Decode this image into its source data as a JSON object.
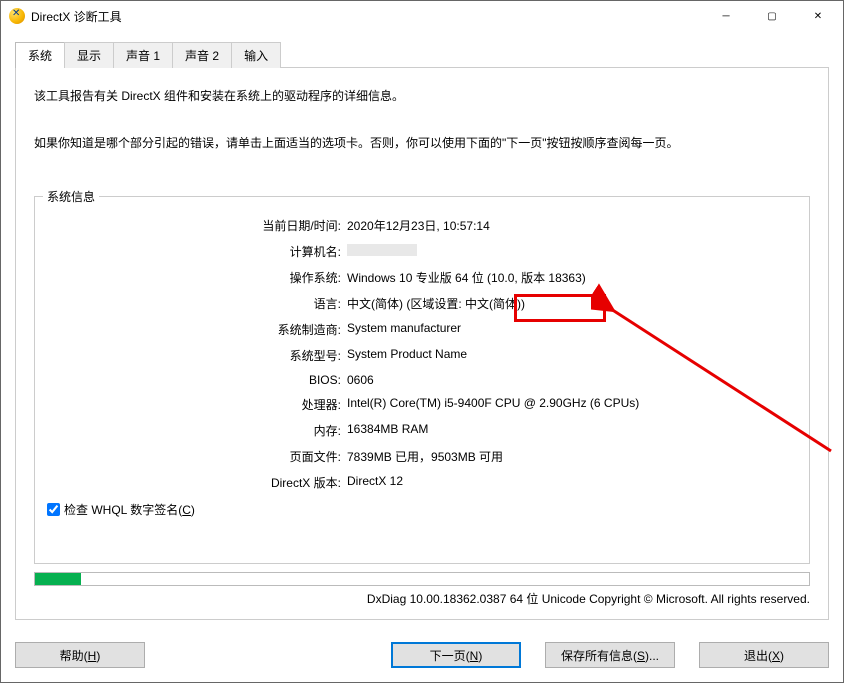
{
  "window": {
    "title": "DirectX 诊断工具"
  },
  "tabs": {
    "system": "系统",
    "display": "显示",
    "sound1": "声音 1",
    "sound2": "声音 2",
    "input": "输入"
  },
  "intro": {
    "line1": "该工具报告有关 DirectX 组件和安装在系统上的驱动程序的详细信息。",
    "line2": "如果你知道是哪个部分引起的错误，请单击上面适当的选项卡。否则，你可以使用下面的\"下一页\"按钮按顺序查阅每一页。"
  },
  "fieldset": {
    "legend": "系统信息"
  },
  "labels": {
    "datetime": "当前日期/时间",
    "computer": "计算机名",
    "os": "操作系统",
    "lang": "语言",
    "manufacturer": "系统制造商",
    "model": "系统型号",
    "bios": "BIOS",
    "cpu": "处理器",
    "mem": "内存",
    "page": "页面文件",
    "dx": "DirectX 版本"
  },
  "values": {
    "datetime": "2020年12月23日, 10:57:14",
    "os_a": "Windows 10 专业版 64 位 (10.0,",
    "os_b": "版本 18363)",
    "lang": "中文(简体) (区域设置: 中文(简体))",
    "manufacturer": "System manufacturer",
    "model": "System Product Name",
    "bios": "0606",
    "cpu": "Intel(R) Core(TM) i5-9400F CPU @ 2.90GHz (6 CPUs)",
    "mem": "16384MB RAM",
    "page": "7839MB 已用，9503MB 可用",
    "dx": "DirectX 12"
  },
  "checkbox": {
    "label_a": "检查 WHQL 数字签名(",
    "label_u": "C",
    "label_b": ")"
  },
  "copyright": "DxDiag 10.00.18362.0387 64 位 Unicode  Copyright © Microsoft. All rights reserved.",
  "buttons": {
    "help_a": "帮助(",
    "help_u": "H",
    "help_b": ")",
    "next_a": "下一页(",
    "next_u": "N",
    "next_b": ")",
    "save_a": "保存所有信息(",
    "save_u": "S",
    "save_b": ")...",
    "exit_a": "退出(",
    "exit_u": "X",
    "exit_b": ")"
  }
}
